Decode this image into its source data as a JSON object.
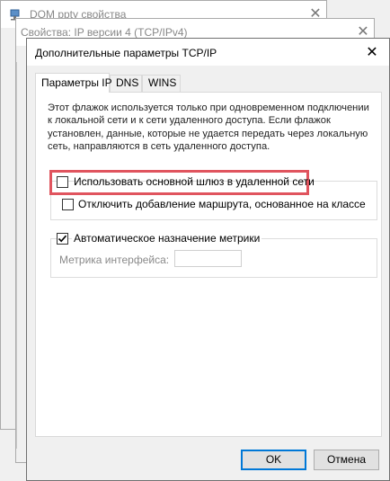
{
  "back_windows": [
    {
      "title": "DOM ppty свойства"
    },
    {
      "title": "Свойства: IP версии 4 (TCP/IPv4)"
    }
  ],
  "dialog": {
    "title": "Дополнительные параметры TCP/IP",
    "close_glyph": "✕"
  },
  "tabs": [
    {
      "label": "Параметры IP",
      "active": true
    },
    {
      "label": "DNS",
      "active": false
    },
    {
      "label": "WINS",
      "active": false
    }
  ],
  "description": "Этот флажок используется только при одновременном подключении к локальной сети и к сети удаленного доступа. Если флажок установлен, данные, которые не удается передать через локальную сеть, направляются в сеть удаленного доступа.",
  "options": {
    "use_gateway": {
      "label": "Использовать основной шлюз в удаленной сети",
      "checked": false
    },
    "disable_route": {
      "label": "Отключить добавление маршрута, основанное на классе",
      "checked": false
    },
    "auto_metric": {
      "label": "Автоматическое назначение метрики",
      "checked": true
    },
    "metric_label": "Метрика интерфейса:",
    "metric_value": ""
  },
  "buttons": {
    "ok": "OK",
    "cancel": "Отмена"
  },
  "colors": {
    "highlight": "#e0545e",
    "default_button_border": "#0078d7"
  }
}
